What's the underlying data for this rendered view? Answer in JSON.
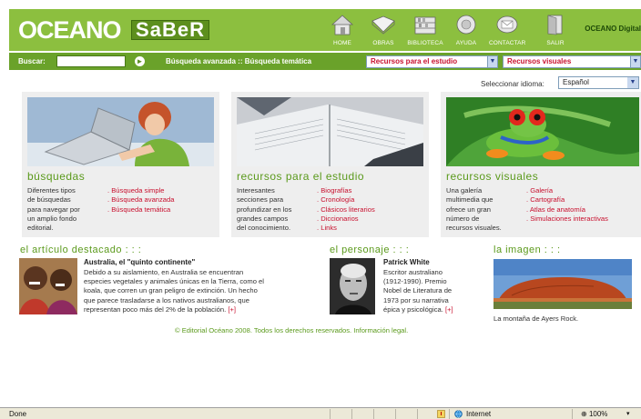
{
  "header": {
    "brand_main": "OCEANO",
    "brand_sub": "SaBeR",
    "brand_right": "OCEANO Digital",
    "nav": [
      {
        "label": "HOME",
        "icon": "home-icon"
      },
      {
        "label": "OBRAS",
        "icon": "book-icon"
      },
      {
        "label": "BIBLIOTECA",
        "icon": "library-icon"
      },
      {
        "label": "AYUDA",
        "icon": "help-icon"
      },
      {
        "label": "CONTACTAR",
        "icon": "contact-icon"
      },
      {
        "label": "SALIR",
        "icon": "exit-icon"
      }
    ],
    "color": "#8cbf3f"
  },
  "search": {
    "label": "Buscar:",
    "value": "",
    "advanced_link": "Búsqueda avanzada",
    "separator": "::",
    "thematic_link": "Búsqueda temática",
    "dropdown_recursos": "Recursos para el estudio",
    "dropdown_visuales": "Recursos visuales",
    "color": "#6aa22a"
  },
  "language": {
    "label": "Seleccionar idioma:",
    "selected": "Español"
  },
  "panels": [
    {
      "title": "búsquedas",
      "description": [
        "Diferentes tipos",
        "de búsquedas",
        "para navegar por",
        "un amplio fondo",
        "editorial."
      ],
      "links": [
        "Búsqueda simple",
        "Búsqueda avanzada",
        "Búsqueda temática"
      ]
    },
    {
      "title": "recursos para el estudio",
      "description": [
        "Interesantes",
        "secciones para",
        "profundizar en los",
        "grandes campos",
        "del conocimiento."
      ],
      "links": [
        "Biografías",
        "Cronología",
        "Clásicos literarios",
        "Diccionarios",
        "Links"
      ]
    },
    {
      "title": "recursos visuales",
      "description": [
        "Una galería",
        "multimedia que",
        "ofrece un gran",
        "número de",
        "recursos visuales."
      ],
      "links": [
        "Galería",
        "Cartografía",
        "Atlas de anatomía",
        "Simulaciones interactivas"
      ]
    }
  ],
  "article": {
    "title": "el artículo destacado : : :",
    "heading": "Australia, el \"quinto continente\"",
    "lines": [
      "Debido a su aislamiento, en Australia se encuentran",
      "especies vegetales y animales únicas en la Tierra, como el",
      "koala, que corren un gran peligro de extinción. Un hecho",
      "que parece trasladarse a los nativos australianos, que",
      "representan poco más del 2% de la población."
    ],
    "more": "[+]"
  },
  "personaje": {
    "title": "el personaje : : :",
    "name": "Patrick White",
    "lines": [
      "Escritor australiano",
      "(1912-1990). Premio",
      "Nobel de Literatura de",
      "1973 por su narrativa",
      "épica y psicológica."
    ],
    "more": "[+]"
  },
  "imagen": {
    "title": "la imagen : : :",
    "caption": "La montaña de Ayers Rock."
  },
  "footer": "© Editorial Océano 2008. Todos los derechos reservados. Información legal.",
  "statusbar": {
    "status": "Done",
    "zone": "Internet",
    "zoom": "100%"
  },
  "colors": {
    "accent": "#5b9a1c",
    "link": "#c8102e",
    "panel_bg": "#eeeeee"
  }
}
